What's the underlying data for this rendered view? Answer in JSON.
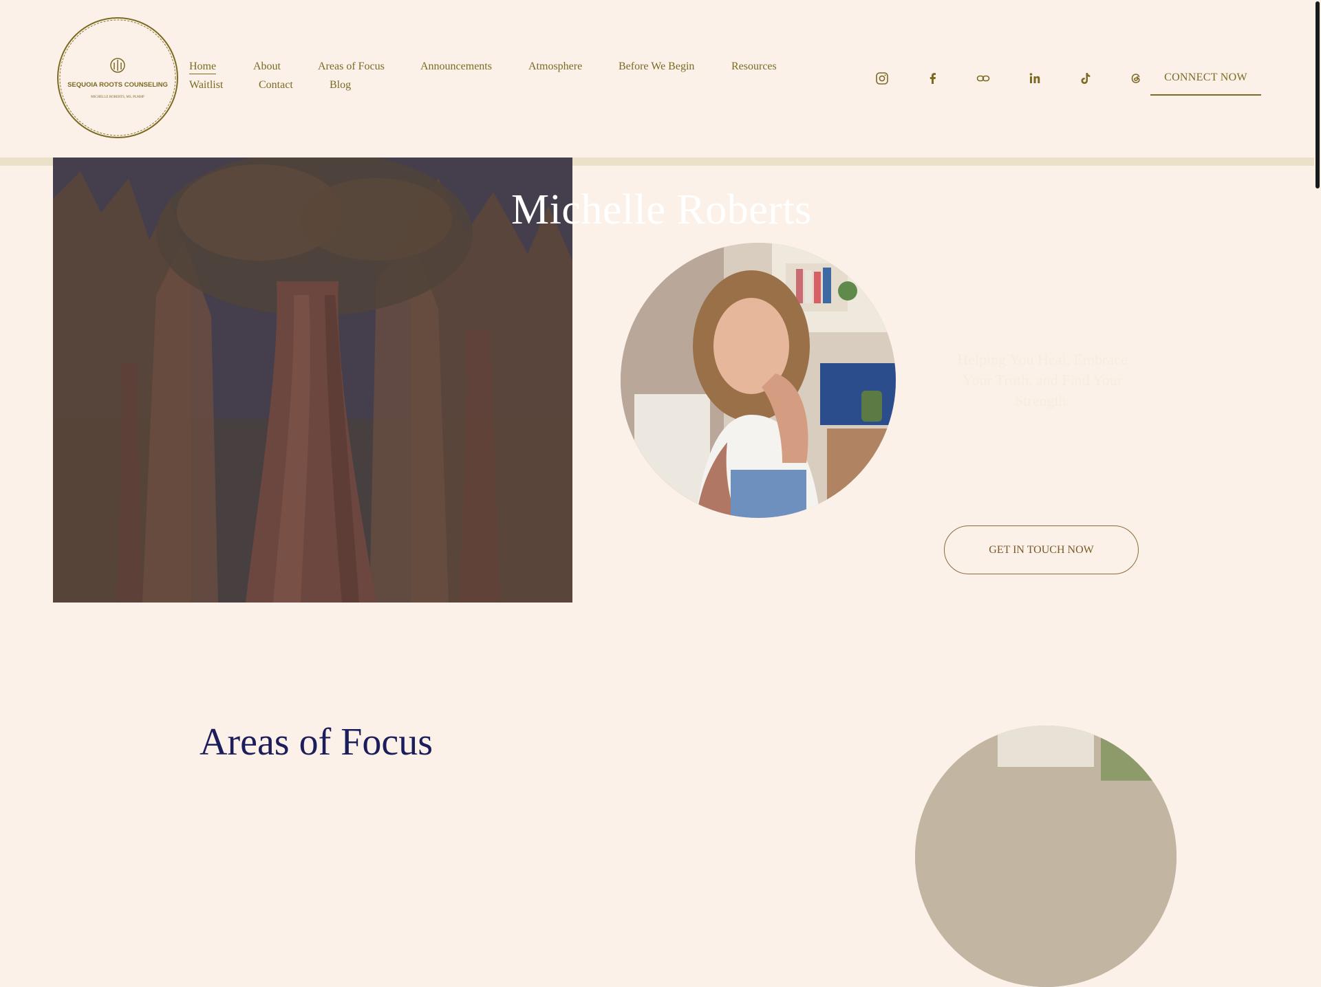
{
  "logo": {
    "name": "SEQUOIA ROOTS COUNSELING",
    "subtitle": "MICHELLE ROBERTS, MS, PLMHP",
    "color": "#7a6a22"
  },
  "nav": {
    "row1": [
      "Home",
      "About",
      "Areas of Focus",
      "Announcements",
      "Atmosphere",
      "Before We Begin",
      "Resources"
    ],
    "row2": [
      "Waitlist",
      "Contact",
      "Blog"
    ],
    "active": "Home"
  },
  "socials": [
    "instagram-icon",
    "facebook-icon",
    "link-icon",
    "linkedin-icon",
    "tiktok-icon",
    "threads-icon"
  ],
  "header_cta": "CONNECT NOW",
  "hero": {
    "title": "Michelle Roberts",
    "tagline": "Helping You Heal, Embrace Your Truth, and Find Your Strength.",
    "cta": "GET IN TOUCH NOW"
  },
  "next_section": {
    "title": "Areas of Focus"
  },
  "colors": {
    "background": "#fcf1e8",
    "accent": "#7a6a22",
    "section_title": "#1b1e5a",
    "rule": "#ebe1c8"
  }
}
